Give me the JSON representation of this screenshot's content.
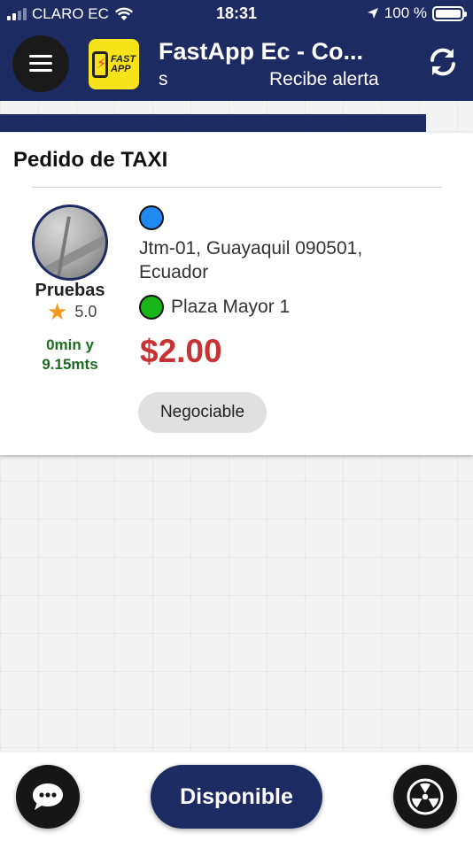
{
  "status_bar": {
    "carrier": "CLARO EC",
    "time": "18:31",
    "battery": "100 %",
    "battery_level": 1.0
  },
  "header": {
    "title": "FastApp Ec - Co...",
    "subtitle_left": "s",
    "subtitle_right": "Recibe alerta",
    "logo_text_1": "FAST",
    "logo_text_2": "APP",
    "menu_icon": "hamburger-menu-icon",
    "refresh_icon": "refresh-icon"
  },
  "progress": {
    "fraction": 0.9
  },
  "order_card": {
    "title": "Pedido de TAXI",
    "driver": {
      "name": "Pruebas",
      "rating": "5.0",
      "eta_line1": "0min y",
      "eta_line2": "9.15mts"
    },
    "origin_line1": "Jtm-01, Guayaquil 090501,",
    "origin_line2": "Ecuador",
    "destination": "Plaza Mayor 1",
    "price": "$2.00",
    "badge": "Negociable",
    "colors": {
      "origin_dot": "#1f8bf2",
      "destination_dot": "#17b517",
      "price": "#c83232",
      "eta": "#1e6b23"
    }
  },
  "bottom_bar": {
    "available_label": "Disponible",
    "chat_icon": "chat-bubble-icon",
    "alert_icon": "radiation-icon"
  },
  "colors": {
    "primary": "#1d2b63",
    "logo_bg": "#f6e31a"
  }
}
